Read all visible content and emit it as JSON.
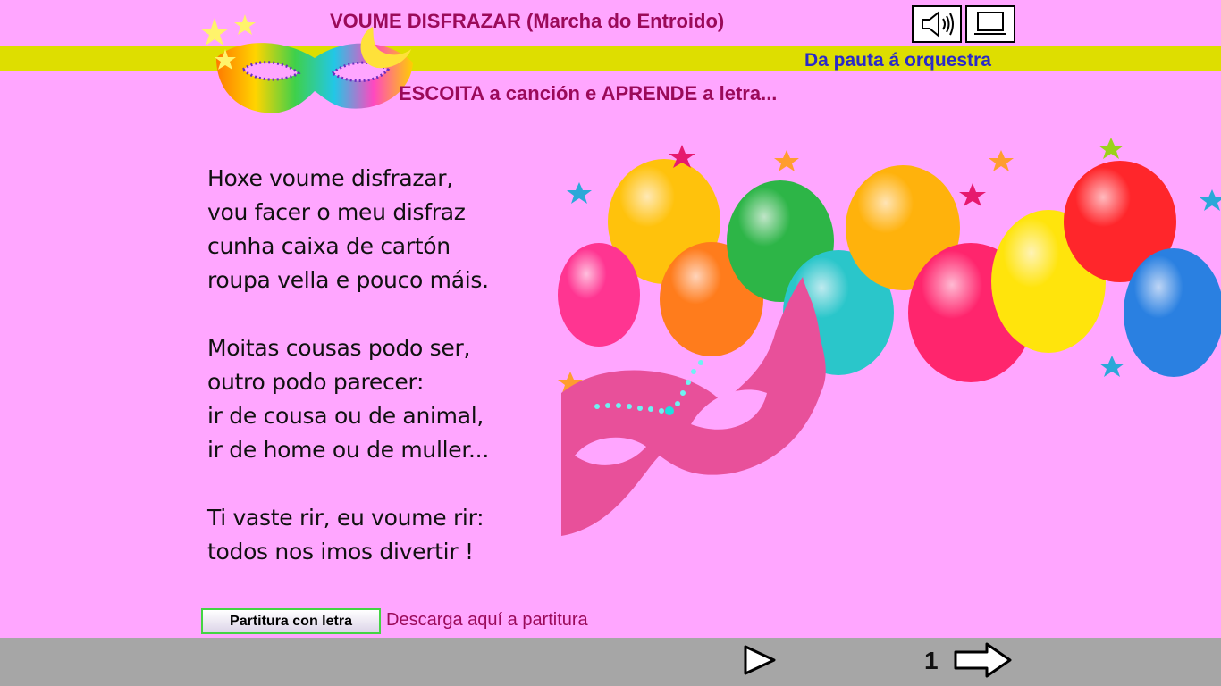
{
  "header": {
    "title": "VOUME DISFRAZAR (Marcha do Entroido)",
    "subtitle": "Da pauta á orquestra",
    "instruction": "ESCOITA a canción e APRENDE a letra...",
    "icons": [
      "speaker-icon",
      "screen-icon"
    ]
  },
  "lyrics": {
    "stanzas": [
      {
        "lines": [
          "Hoxe voume disfrazar,",
          "vou facer o meu disfraz",
          "cunha caixa de cartón",
          "roupa vella e pouco máis."
        ]
      },
      {
        "lines": [
          "Moitas cousas podo ser,",
          "outro podo parecer:",
          "ir de cousa ou de animal,",
          "ir de home ou de muller..."
        ]
      },
      {
        "lines": [
          "Ti vaste rir, eu voume rir:",
          "todos nos imos divertir !"
        ]
      }
    ]
  },
  "footer": {
    "score_button_label": "Partitura con letra",
    "download_text": "Descarga aquí a partitura",
    "page_number": "1",
    "icons": [
      "play-icon",
      "next-arrow-icon"
    ]
  },
  "colors": {
    "background": "#ffa6ff",
    "band": "#dede00",
    "title": "#9b0a5a",
    "subtitle": "#2a2ac8",
    "footer": "#a6a6a6"
  }
}
